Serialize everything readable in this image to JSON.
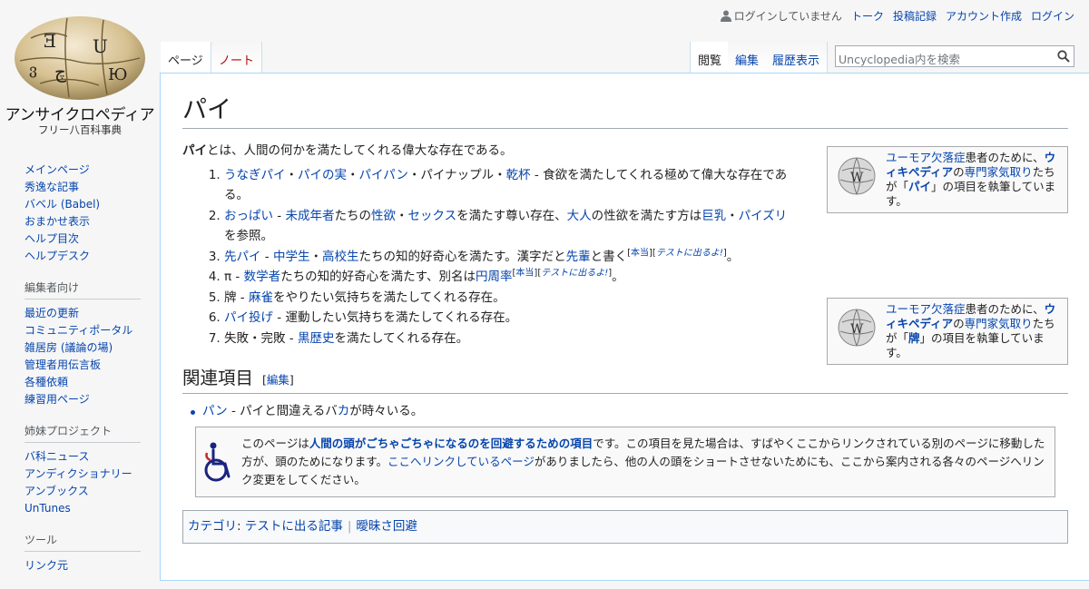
{
  "site": {
    "name": "アンサイクロペディア",
    "tagline": "フリー八百科事典"
  },
  "personal": {
    "status": "ログインしていません",
    "links": [
      "トーク",
      "投稿記録",
      "アカウント作成",
      "ログイン"
    ]
  },
  "tabs": {
    "page": "ページ",
    "talk": "ノート",
    "read": "閲覧",
    "edit": "編集",
    "history": "履歴表示"
  },
  "search": {
    "placeholder": "Uncyclopedia内を検索"
  },
  "sidebar": {
    "main": [
      "メインページ",
      "秀逸な記事",
      "バベル (Babel)",
      "おまかせ表示",
      "ヘルプ目次",
      "ヘルプデスク"
    ],
    "editors_head": "編集者向け",
    "editors": [
      "最近の更新",
      "コミュニティポータル",
      "雑居房 (議論の場)",
      "管理者用伝言板",
      "各種依頼",
      "練習用ページ"
    ],
    "sister_head": "姉妹プロジェクト",
    "sister": [
      "バ科ニュース",
      "アンディクショナリー",
      "アンブックス",
      "UnTunes"
    ],
    "tools_head": "ツール",
    "tools": [
      "リンク元"
    ]
  },
  "article": {
    "title": "パイ",
    "intro_bold": "パイ",
    "intro_rest": "とは、人間の何かを満たしてくれる偉大な存在である。",
    "items": {
      "i1": {
        "a": "うなぎパイ",
        "s1": "・",
        "b": "パイの実",
        "s2": "・",
        "c": "パイパン",
        "s3": "・パイナップル・",
        "d": "乾杯",
        "rest": " - 食欲を満たしてくれる極めて偉大な存在である。"
      },
      "i2": {
        "a": "おっぱい",
        "s1": " - ",
        "b": "未成年者",
        "s2": "たちの",
        "c": "性欲",
        "s3": "・",
        "d": "セックス",
        "s4": "を満たす尊い存在、",
        "e": "大人",
        "s5": "の性欲を満たす方は",
        "f": "巨乳",
        "s6": "・",
        "g": "パイズリ",
        "rest": "を参照。"
      },
      "i3": {
        "a": "先パイ",
        "s1": " - ",
        "b": "中学生",
        "s2": "・",
        "c": "高校生",
        "s3": "たちの知的好奇心を満たす。漢字だと",
        "d": "先輩",
        "s4": "と書く",
        "sup1": "本当",
        "sup2": "テストに出るよ!",
        "end": "。"
      },
      "i4": {
        "pre": "π - ",
        "a": "数学者",
        "s1": "たちの知的好奇心を満たす、別名は",
        "b": "円周率",
        "sup1": "本当",
        "sup2": "テストに出るよ!",
        "end": "。"
      },
      "i5": {
        "pre": "牌 - ",
        "a": "麻雀",
        "rest": "をやりたい気持ちを満たしてくれる存在。"
      },
      "i6": {
        "a": "パイ投げ",
        "rest": " - 運動したい気持ちを満たしてくれる存在。"
      },
      "i7": {
        "pre": "失敗・完敗 - ",
        "a": "黒歴史",
        "rest": "を満たしてくれる存在。"
      }
    },
    "ambox1": {
      "a": "ユーモア欠落症",
      "s1": "患者のために、",
      "b": "ウィキペディア",
      "s2": "の",
      "c": "専門家気取り",
      "s3": "たちが「",
      "d": "パイ",
      "s4": "」の項目を執筆しています。"
    },
    "ambox2": {
      "a": "ユーモア欠落症",
      "s1": "患者のために、",
      "b": "ウィキペディア",
      "s2": "の",
      "c": "専門家気取り",
      "s3": "たちが「",
      "d": "牌",
      "s4": "」の項目を執筆しています。"
    },
    "related": {
      "heading": "関連項目",
      "edit": "編集",
      "item": {
        "a": "パン",
        "s1": " - パイと間違えるバ",
        "b": "カ",
        "rest": "が時々いる。"
      }
    },
    "disambig": {
      "t1": "このページは",
      "b1": "人間の頭がごちゃごちゃになるのを回避するための項目",
      "t2": "です。この項目を見た場合は、すばやくここからリンクされている別のページに移動した方が、頭のためになります。",
      "l1": "ここへリンクしているページ",
      "t3": "がありましたら、他の人の頭をショートさせないためにも、ここから案内される各々のページへリンク変更をしてください。"
    },
    "categories": {
      "label": "カテゴリ",
      "items": [
        "テストに出る記事",
        "曖昧さ回避"
      ]
    }
  }
}
